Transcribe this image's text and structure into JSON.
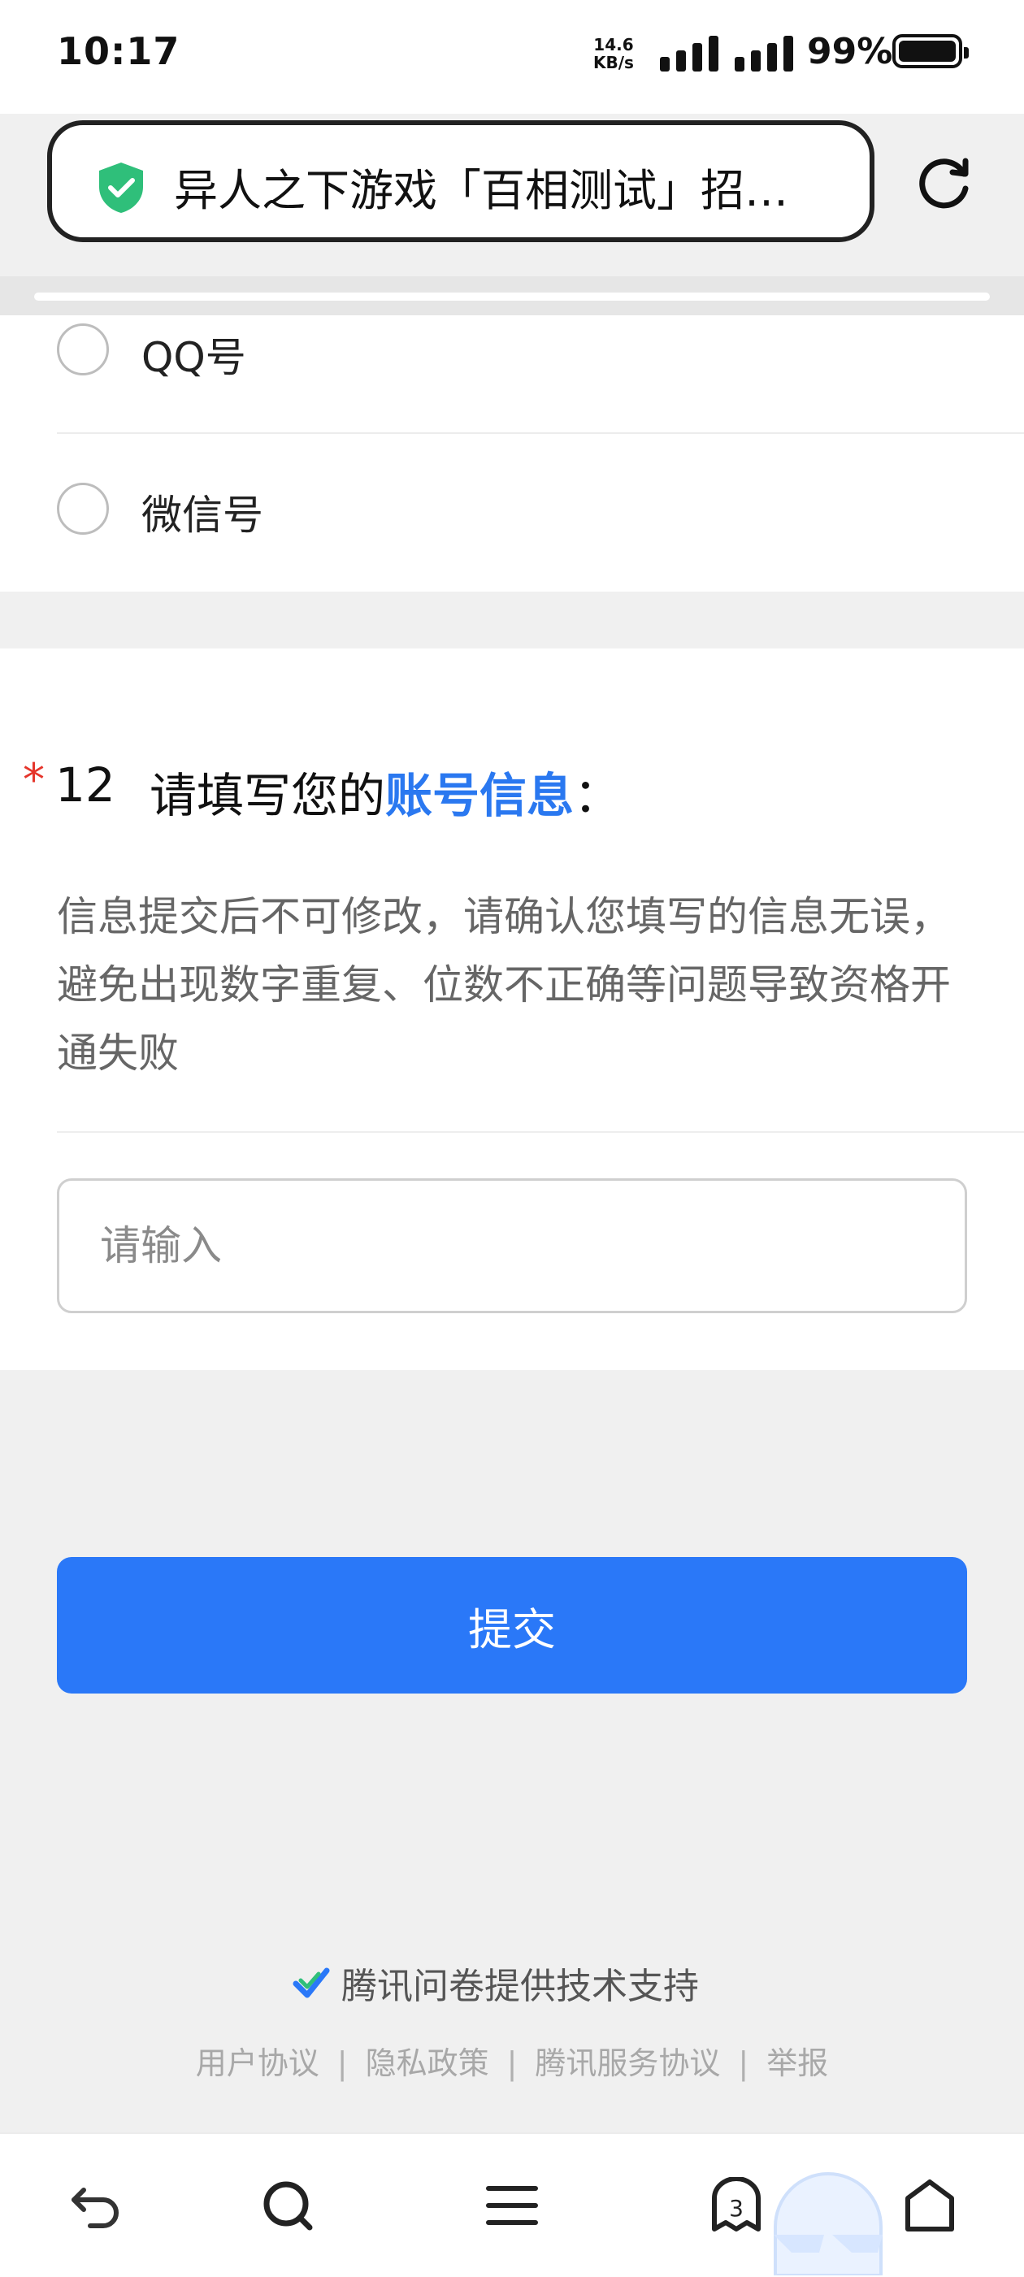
{
  "status_bar": {
    "time": "10:17",
    "net_speed_value": "14.6",
    "net_speed_unit": "KB/s",
    "battery_percent": "99%"
  },
  "browser": {
    "page_title": "异人之下游戏「百相测试」招…",
    "tab_count": "3"
  },
  "question_prev": {
    "options": [
      {
        "label": "QQ号"
      },
      {
        "label": "微信号"
      }
    ]
  },
  "question": {
    "required_mark": "*",
    "number": "12",
    "text_prefix": "请填写您的",
    "text_highlight": "账号信息",
    "text_suffix": "：",
    "description": "信息提交后不可修改，请确认您填写的信息无误，避免出现数字重复、位数不正确等问题导致资格开通失败",
    "input_placeholder": "请输入",
    "input_value": ""
  },
  "submit_label": "提交",
  "footer": {
    "powered_by": "腾讯问卷提供技术支持",
    "links": [
      "用户协议",
      "隐私政策",
      "腾讯服务协议",
      "举报"
    ],
    "separator": "|"
  },
  "colors": {
    "accent": "#2a78f8",
    "required": "#e5352b",
    "shield": "#2fbf7a"
  }
}
